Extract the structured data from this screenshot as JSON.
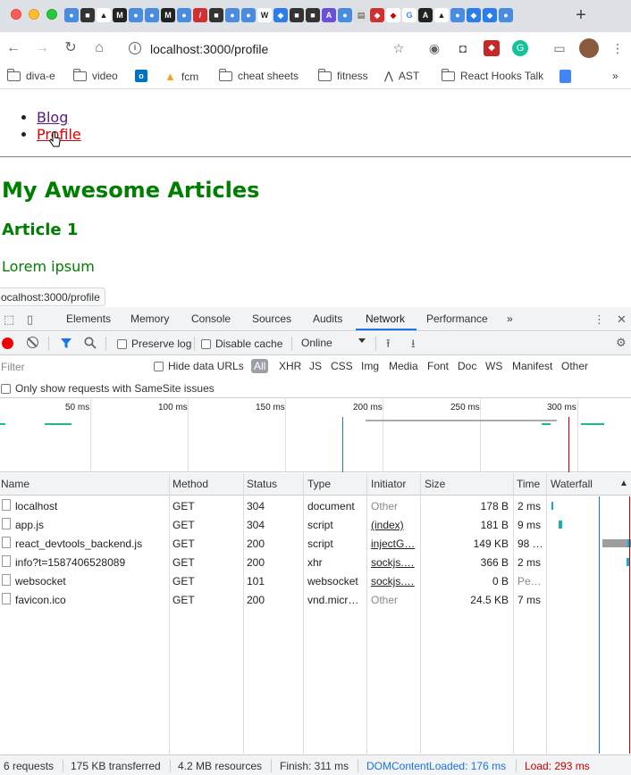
{
  "browser": {
    "url": "localhost:3000/profile",
    "new_tab_label": "+",
    "bookmarks": [
      "diva-e",
      "video",
      "fcm",
      "cheat sheets",
      "fitness",
      "AST",
      "React Hooks Talk"
    ],
    "bookmarks_overflow": "»"
  },
  "page": {
    "nav": [
      {
        "label": "Blog"
      },
      {
        "label": "Profile"
      }
    ],
    "heading": "My Awesome Articles",
    "article_title": "Article 1",
    "article_body": "Lorem ipsum",
    "status_tooltip": "ocalhost:3000/profile"
  },
  "devtools": {
    "tabs": [
      "Elements",
      "Memory",
      "Console",
      "Sources",
      "Audits",
      "Network",
      "Performance"
    ],
    "active_tab": "Network",
    "more_tabs": "»",
    "toolbar": {
      "preserve_log": "Preserve log",
      "disable_cache": "Disable cache",
      "throttling": "Online"
    },
    "filter": {
      "placeholder": "Filter",
      "hide_data_urls": "Hide data URLs",
      "types": [
        "All",
        "XHR",
        "JS",
        "CSS",
        "Img",
        "Media",
        "Font",
        "Doc",
        "WS",
        "Manifest",
        "Other"
      ]
    },
    "samesite_label": "Only show requests with SameSite issues",
    "overview_ticks": [
      "50 ms",
      "100 ms",
      "150 ms",
      "200 ms",
      "250 ms",
      "300 ms"
    ],
    "columns": [
      "Name",
      "Method",
      "Status",
      "Type",
      "Initiator",
      "Size",
      "Time",
      "Waterfall"
    ],
    "sort_indicator": "▲",
    "requests": [
      {
        "name": "localhost",
        "method": "GET",
        "status": "304",
        "type": "document",
        "initiator": "Other",
        "size": "178 B",
        "time": "2 ms"
      },
      {
        "name": "app.js",
        "method": "GET",
        "status": "304",
        "type": "script",
        "initiator": "(index)",
        "size": "181 B",
        "time": "9 ms"
      },
      {
        "name": "react_devtools_backend.js",
        "method": "GET",
        "status": "200",
        "type": "script",
        "initiator": "injectG…",
        "size": "149 KB",
        "time": "98 …"
      },
      {
        "name": "info?t=1587406528089",
        "method": "GET",
        "status": "200",
        "type": "xhr",
        "initiator": "sockjs.…",
        "size": "366 B",
        "time": "2 ms"
      },
      {
        "name": "websocket",
        "method": "GET",
        "status": "101",
        "type": "websocket",
        "initiator": "sockjs.…",
        "size": "0 B",
        "time": "Pe…"
      },
      {
        "name": "favicon.ico",
        "method": "GET",
        "status": "200",
        "type": "vnd.micr…",
        "initiator": "Other",
        "size": "24.5 KB",
        "time": "7 ms"
      }
    ],
    "status": {
      "requests": "6 requests",
      "transferred": "175 KB transferred",
      "resources": "4.2 MB resources",
      "finish": "Finish: 311 ms",
      "dom_content_loaded": "DOMContentLoaded: 176 ms",
      "load": "Load: 293 ms"
    },
    "colors": {
      "accent": "#1a73e8",
      "dcl_line": "#1a73e8",
      "load_line": "#c80000",
      "record": "#e00000"
    }
  }
}
